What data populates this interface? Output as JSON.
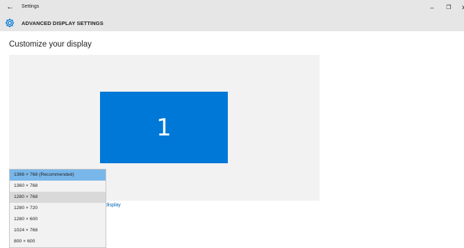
{
  "window": {
    "title": "Settings",
    "back_glyph": "←",
    "minimize_glyph": "–",
    "maximize_glyph": "❐",
    "close_glyph": "✕"
  },
  "header": {
    "icon": "gear-icon",
    "title": "ADVANCED DISPLAY SETTINGS"
  },
  "main": {
    "section_title": "Customize your display",
    "monitor_number": "1",
    "link_fragment": "display",
    "colors": {
      "monitor": "#0078d7",
      "selected": "#79b7ea",
      "link": "#0063b1"
    }
  },
  "resolution_dropdown": {
    "selected_index": 0,
    "hover_index": 2,
    "options": [
      "1366 × 768 (Recommended)",
      "1360 × 768",
      "1280 × 768",
      "1280 × 720",
      "1280 × 600",
      "1024 × 768",
      "800 × 600"
    ]
  }
}
